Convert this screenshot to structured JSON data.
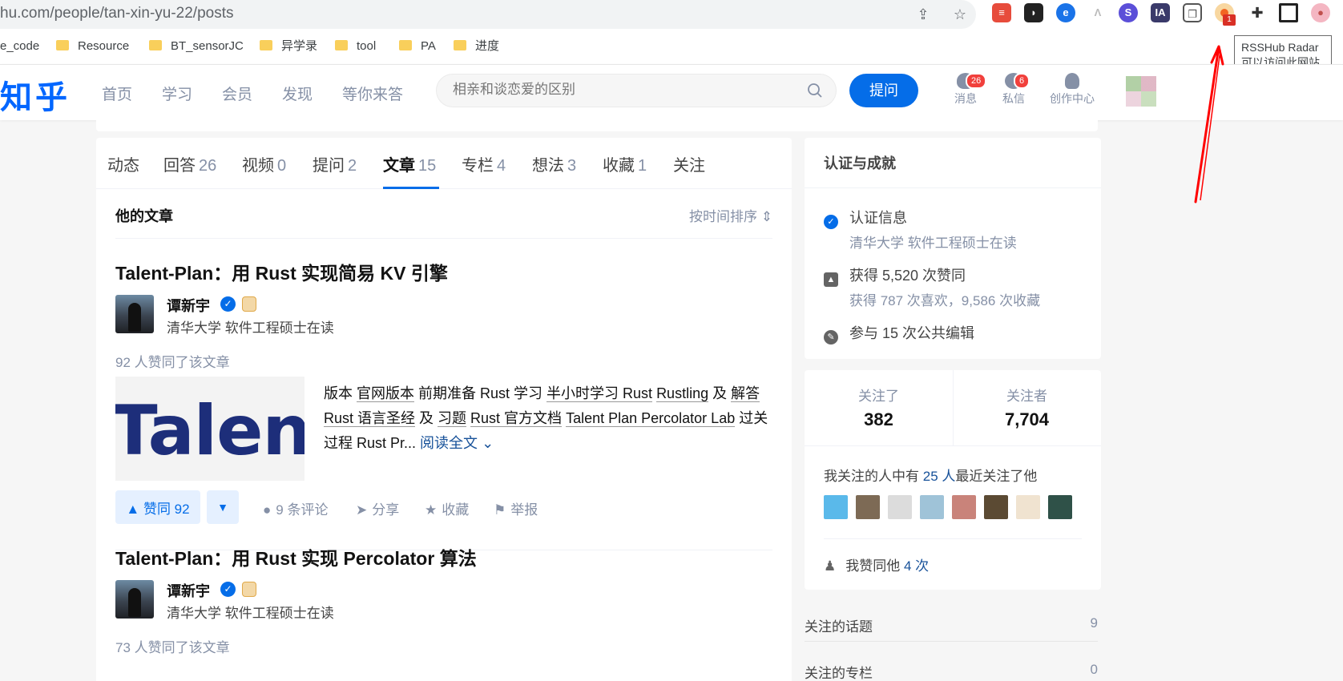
{
  "browser": {
    "url_host": "hu.com",
    "url_path": "/people/tan-xin-yu-22/posts",
    "bookmarks": [
      "e_code",
      "Resource",
      "BT_sensorJC",
      "异学录",
      "tool",
      "PA",
      "进度"
    ],
    "extension_badge": "1",
    "tooltip_title": "RSSHub Radar",
    "tooltip_desc": "可以访问此网站"
  },
  "header": {
    "logo": "知乎",
    "nav": [
      "首页",
      "学习",
      "会员",
      "发现",
      "等你来答"
    ],
    "search_placeholder": "相亲和谈恋爱的区别",
    "ask_label": "提问",
    "messages_label": "消息",
    "messages_count": "26",
    "pm_label": "私信",
    "pm_count": "6",
    "creator_label": "创作中心"
  },
  "tabs": [
    {
      "label": "动态",
      "count": ""
    },
    {
      "label": "回答",
      "count": "26"
    },
    {
      "label": "视频",
      "count": "0"
    },
    {
      "label": "提问",
      "count": "2"
    },
    {
      "label": "文章",
      "count": "15"
    },
    {
      "label": "专栏",
      "count": "4"
    },
    {
      "label": "想法",
      "count": "3"
    },
    {
      "label": "收藏",
      "count": "1"
    },
    {
      "label": "关注",
      "count": ""
    }
  ],
  "section": {
    "title": "他的文章",
    "sort": "按时间排序"
  },
  "articles": [
    {
      "title": "Talent-Plan：用 Rust 实现简易 KV 引擎",
      "author": "谭新宇",
      "bio": "清华大学 软件工程硕士在读",
      "likes_line": "92 人赞同了该文章",
      "thumb_text": "Talent",
      "excerpt_parts": [
        "版本 ",
        "官网版本",
        " 前期准备 Rust 学习 ",
        "半小时学习 Rust",
        " ",
        "Rustling",
        " 及 ",
        "解答",
        " ",
        "Rust 语言圣经",
        " 及 ",
        "习题",
        " ",
        "Rust 官方文档",
        " ",
        "Talent Plan Percolator Lab",
        " 过关过程 Rust Pr..."
      ],
      "read_more": "阅读全文",
      "vote": "赞同 92",
      "comments": "9 条评论",
      "share": "分享",
      "collect": "收藏",
      "report": "举报"
    },
    {
      "title": "Talent-Plan：用 Rust 实现 Percolator 算法",
      "author": "谭新宇",
      "bio": "清华大学 软件工程硕士在读",
      "likes_line": "73 人赞同了该文章"
    }
  ],
  "sidebar": {
    "achievements_title": "认证与成就",
    "cert_label": "认证信息",
    "cert_detail": "清华大学 软件工程硕士在读",
    "agree_label": "获得 5,520 次赞同",
    "agree_detail": "获得 787 次喜欢，9,586 次收藏",
    "edit_label": "参与 15 次公共编辑",
    "following_label": "关注了",
    "following_value": "382",
    "followers_label": "关注者",
    "followers_value": "7,704",
    "mutual_prefix": "我关注的人中有 ",
    "mutual_count": "25 人",
    "mutual_suffix": "最近关注了他",
    "my_agree_prefix": "我赞同他 ",
    "my_agree_count": "4 次",
    "topics_label": "关注的话题",
    "topics_count": "9",
    "columns_label": "关注的专栏",
    "columns_count": "0"
  },
  "colors": {
    "brand": "#056de8",
    "logo": "#0066ff",
    "muted": "#8590a6",
    "annotation_arrow": "#ff0000"
  }
}
